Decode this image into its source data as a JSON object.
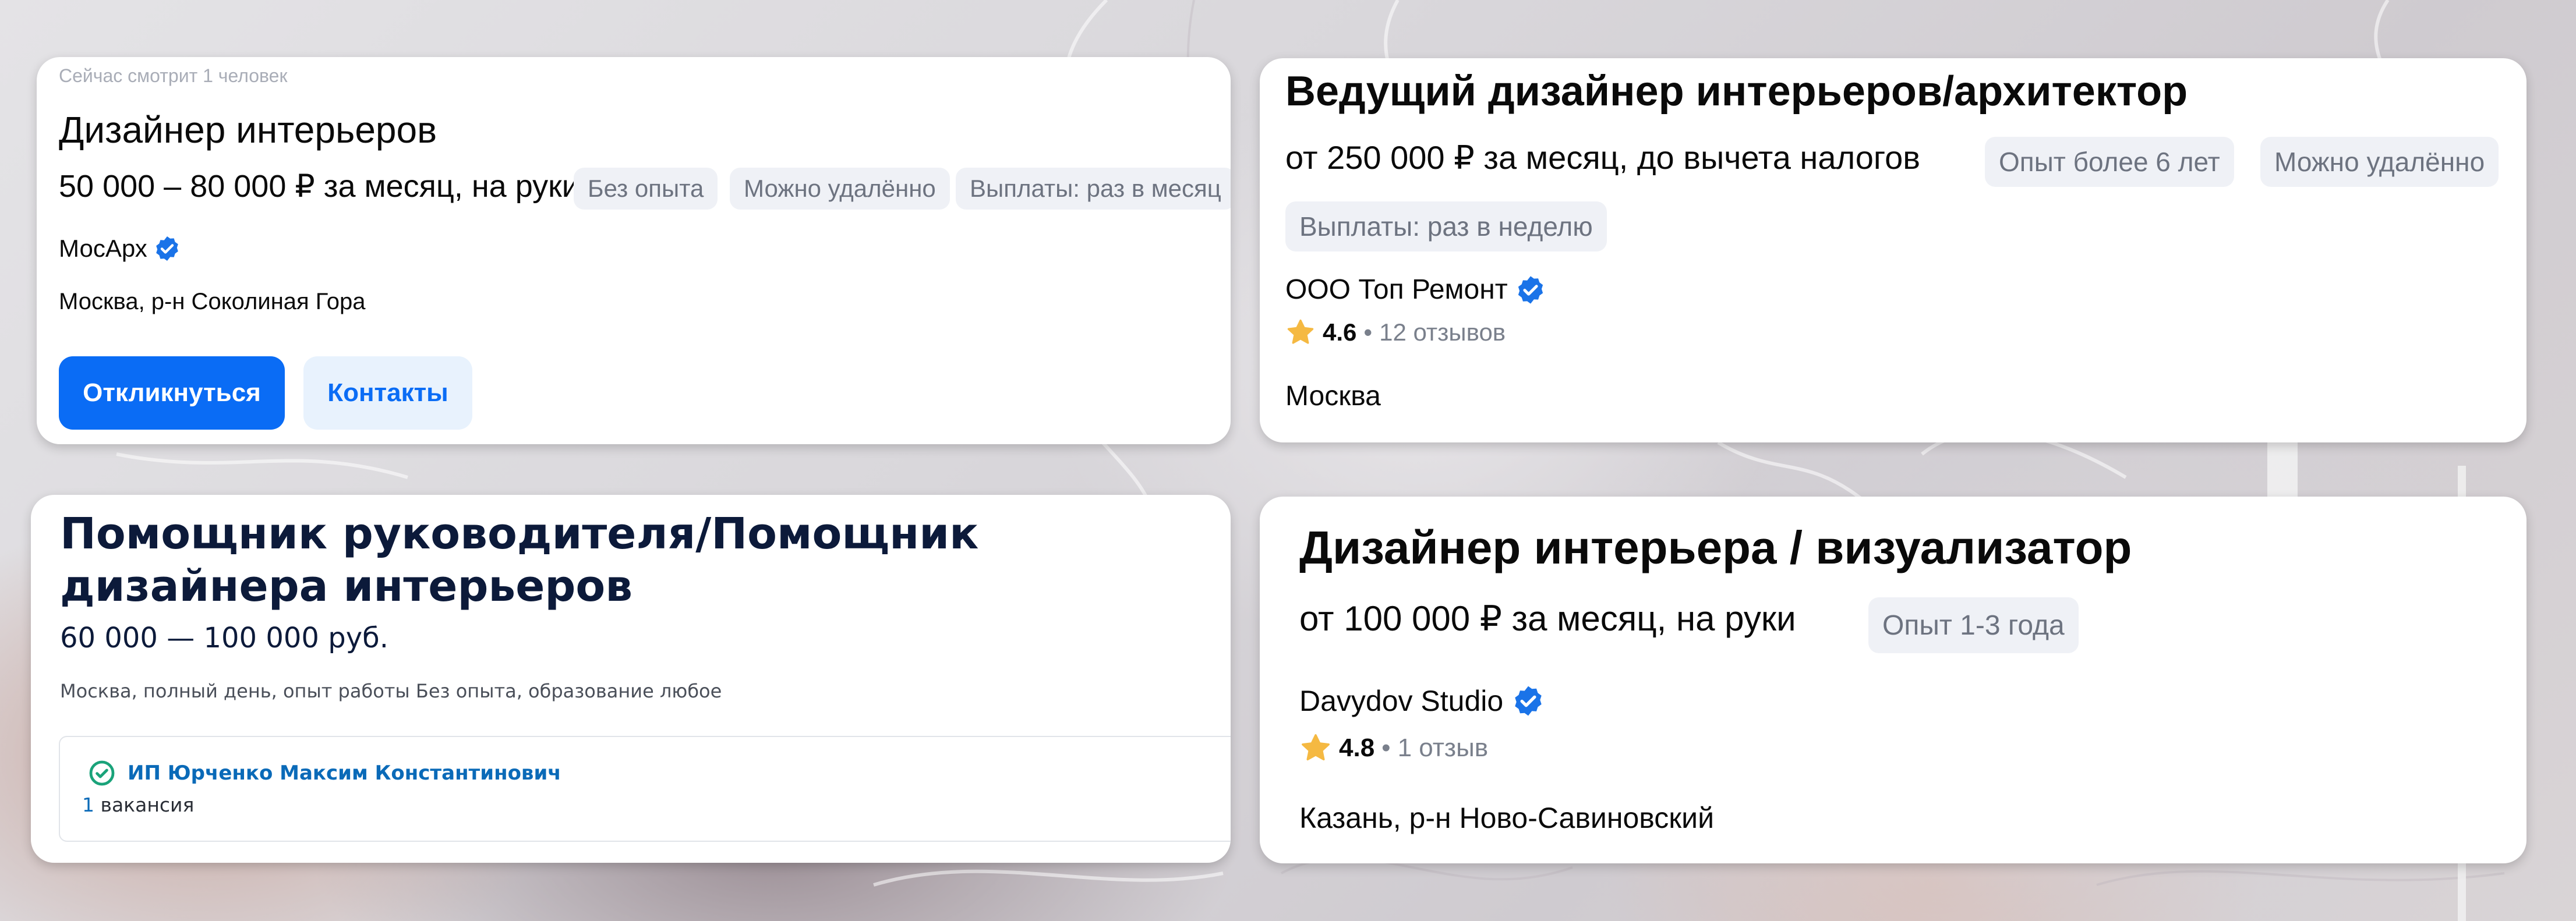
{
  "colors": {
    "accent_blue": "#0a6cf5",
    "verified_blue": "#1a73e8",
    "tag_bg": "#eff1f6",
    "tag_text": "#6d7380",
    "star": "#f5b942",
    "hh_green": "#1aa37a",
    "hh_link": "#0a6ab8"
  },
  "card1": {
    "viewers": "Сейчас смотрит 1 человек",
    "title": "Дизайнер интерьеров",
    "salary": "50 000 – 80 000 ₽ за месяц, на руки",
    "tags": [
      "Без опыта",
      "Можно удалённо",
      "Выплаты: раз в месяц"
    ],
    "company": "МосАрх",
    "company_icon": "verified-icon",
    "address": "Москва, р-н Соколиная Гора",
    "respond_button": "Откликнуться",
    "contacts_button": "Контакты"
  },
  "card2": {
    "title": "Ведущий дизайнер интерьеров/архитектор",
    "salary": "от 250 000 ₽ за месяц, до вычета налогов",
    "tags": [
      "Опыт более 6 лет",
      "Можно удалённо",
      "Выплаты: раз в неделю"
    ],
    "company": "ООО Топ Ремонт",
    "company_icon": "verified-icon",
    "rating": "4.6",
    "separator": "•",
    "reviews": "12 отзывов",
    "city": "Москва"
  },
  "card3": {
    "title": "Помощник руководителя/Помощник дизайнера интерьеров",
    "salary": "60 000 — 100 000 руб.",
    "meta": "Москва, полный день, опыт работы Без опыта, образование любое",
    "employer": "ИП Юрченко Максим Константинович",
    "employer_icon": "check-circle-icon",
    "vacancy_count": "1",
    "vacancy_label": "вакансия"
  },
  "card4": {
    "title": "Дизайнер интерьера / визуализатор",
    "salary": "от 100 000 ₽ за месяц, на руки",
    "tag": "Опыт 1-3 года",
    "company": "Davydov Studio",
    "company_icon": "verified-icon",
    "rating": "4.8",
    "separator": "•",
    "reviews": "1 отзыв",
    "city": "Казань, р-н Ново-Савиновский"
  }
}
